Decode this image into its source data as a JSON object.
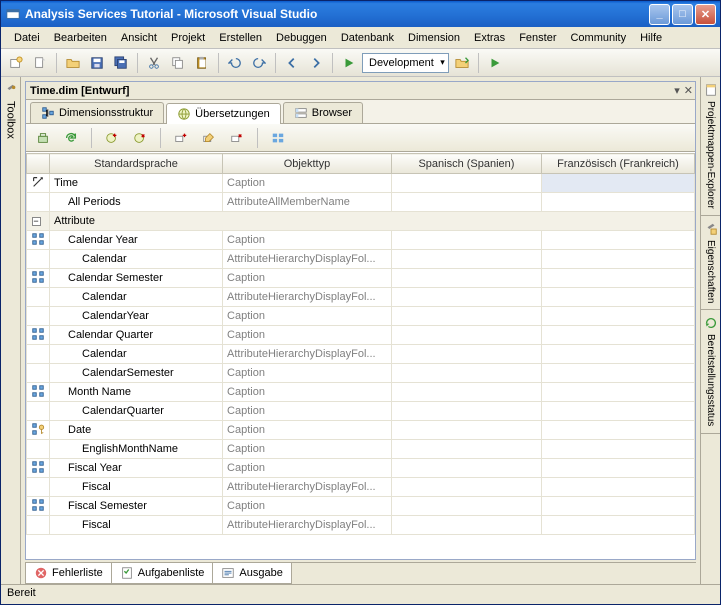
{
  "window": {
    "title": "Analysis Services Tutorial - Microsoft Visual Studio"
  },
  "menu": [
    "Datei",
    "Bearbeiten",
    "Ansicht",
    "Projekt",
    "Erstellen",
    "Debuggen",
    "Datenbank",
    "Dimension",
    "Extras",
    "Fenster",
    "Community",
    "Hilfe"
  ],
  "toolbar": {
    "config": "Development"
  },
  "left": {
    "toolbox": "Toolbox"
  },
  "right": [
    "Projektmappen-Explorer",
    "Eigenschaften",
    "Bereitstellungsstatus"
  ],
  "doc": {
    "title": "Time.dim [Entwurf]",
    "tabs": [
      "Dimensionsstruktur",
      "Übersetzungen",
      "Browser"
    ]
  },
  "grid": {
    "cols": [
      "Standardsprache",
      "Objekttyp",
      "Spanisch (Spanien)",
      "Französisch (Frankreich)"
    ],
    "rows": [
      {
        "icon": "dim",
        "indent": 0,
        "c0": "Time",
        "c1": "Caption",
        "c2": "",
        "c3": "",
        "sel": true
      },
      {
        "icon": "",
        "indent": 1,
        "c0": "All Periods",
        "c1": "AttributeAllMemberName",
        "c2": "",
        "c3": ""
      },
      {
        "group": true,
        "c0": "Attribute"
      },
      {
        "icon": "attr",
        "indent": 1,
        "c0": "Calendar Year",
        "c1": "Caption",
        "c2": "",
        "c3": ""
      },
      {
        "icon": "",
        "indent": 2,
        "c0": "Calendar",
        "c1": "AttributeHierarchyDisplayFol...",
        "c2": "",
        "c3": ""
      },
      {
        "icon": "attr",
        "indent": 1,
        "c0": "Calendar Semester",
        "c1": "Caption",
        "c2": "",
        "c3": ""
      },
      {
        "icon": "",
        "indent": 2,
        "c0": "Calendar",
        "c1": "AttributeHierarchyDisplayFol...",
        "c2": "",
        "c3": ""
      },
      {
        "icon": "",
        "indent": 2,
        "c0": "CalendarYear",
        "c1": "Caption",
        "c2": "",
        "c3": ""
      },
      {
        "icon": "attr",
        "indent": 1,
        "c0": "Calendar Quarter",
        "c1": "Caption",
        "c2": "",
        "c3": ""
      },
      {
        "icon": "",
        "indent": 2,
        "c0": "Calendar",
        "c1": "AttributeHierarchyDisplayFol...",
        "c2": "",
        "c3": ""
      },
      {
        "icon": "",
        "indent": 2,
        "c0": "CalendarSemester",
        "c1": "Caption",
        "c2": "",
        "c3": ""
      },
      {
        "icon": "attr",
        "indent": 1,
        "c0": "Month Name",
        "c1": "Caption",
        "c2": "",
        "c3": ""
      },
      {
        "icon": "",
        "indent": 2,
        "c0": "CalendarQuarter",
        "c1": "Caption",
        "c2": "",
        "c3": ""
      },
      {
        "icon": "key",
        "indent": 1,
        "c0": "Date",
        "c1": "Caption",
        "c2": "",
        "c3": ""
      },
      {
        "icon": "",
        "indent": 2,
        "c0": "EnglishMonthName",
        "c1": "Caption",
        "c2": "",
        "c3": ""
      },
      {
        "icon": "attr",
        "indent": 1,
        "c0": "Fiscal Year",
        "c1": "Caption",
        "c2": "",
        "c3": ""
      },
      {
        "icon": "",
        "indent": 2,
        "c0": "Fiscal",
        "c1": "AttributeHierarchyDisplayFol...",
        "c2": "",
        "c3": ""
      },
      {
        "icon": "attr",
        "indent": 1,
        "c0": "Fiscal Semester",
        "c1": "Caption",
        "c2": "",
        "c3": ""
      },
      {
        "icon": "",
        "indent": 2,
        "c0": "Fiscal",
        "c1": "AttributeHierarchyDisplayFol...",
        "c2": "",
        "c3": ""
      }
    ]
  },
  "bottom": [
    "Fehlerliste",
    "Aufgabenliste",
    "Ausgabe"
  ],
  "status": "Bereit"
}
